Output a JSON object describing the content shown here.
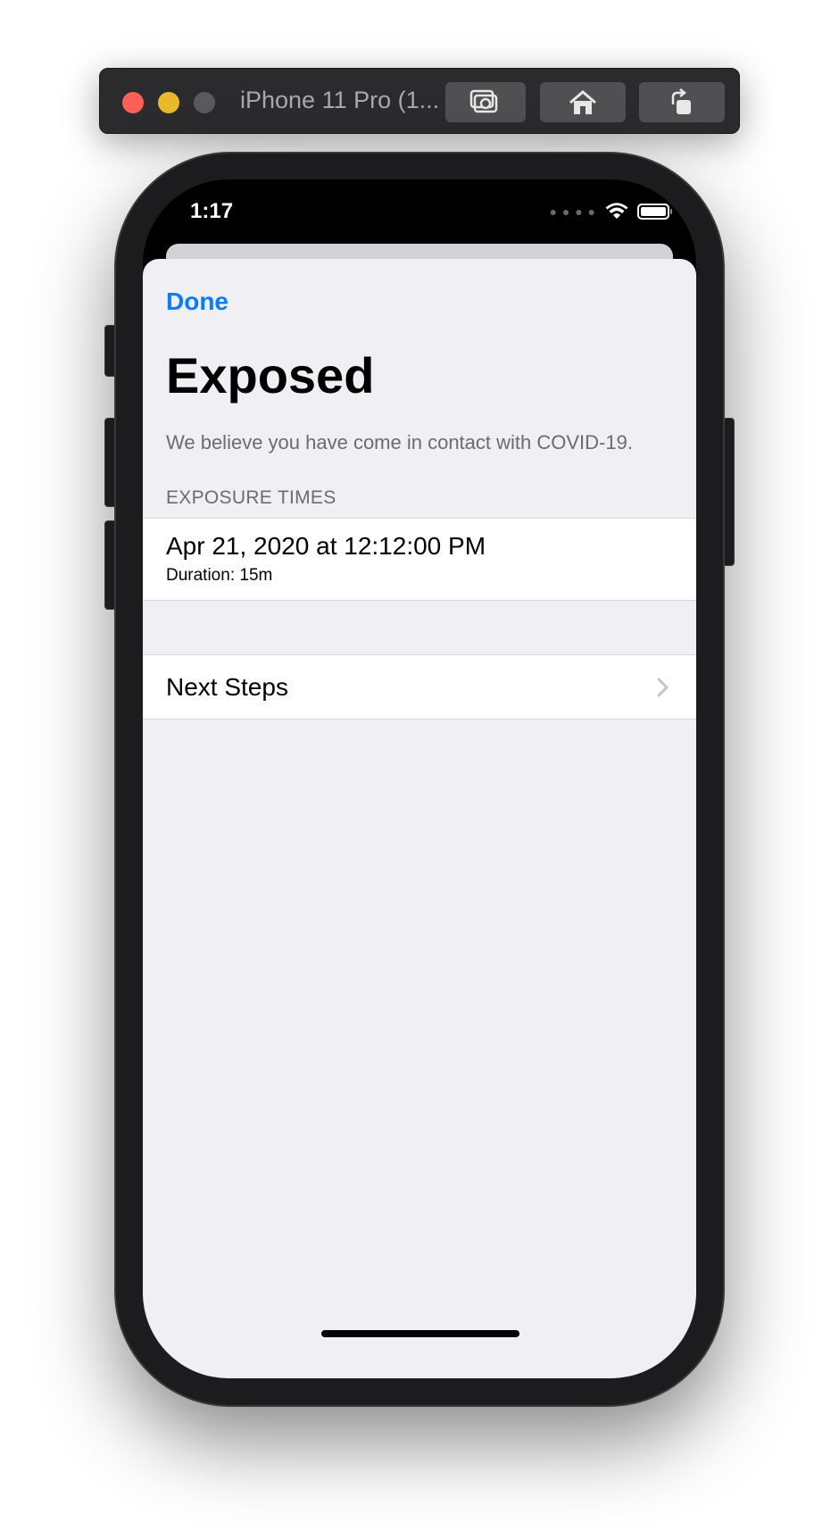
{
  "simulator": {
    "title": "iPhone 11 Pro (1...",
    "icons": {
      "screenshot": "camera-icon",
      "home": "home-icon",
      "rotate": "rotate-icon"
    }
  },
  "status_bar": {
    "time": "1:17",
    "icons": [
      "signal-icon",
      "wifi-icon",
      "battery-icon"
    ]
  },
  "sheet": {
    "done_label": "Done",
    "title": "Exposed",
    "subtitle": "We believe you have come in contact with COVID-19.",
    "section_header": "EXPOSURE TIMES",
    "exposures": [
      {
        "date": "Apr 21, 2020 at 12:12:00 PM",
        "duration": "Duration: 15m"
      }
    ],
    "next_steps_label": "Next Steps"
  },
  "colors": {
    "accent": "#0a7aff",
    "sheet_background": "#efeff4",
    "secondary_text": "#6c6c70"
  }
}
